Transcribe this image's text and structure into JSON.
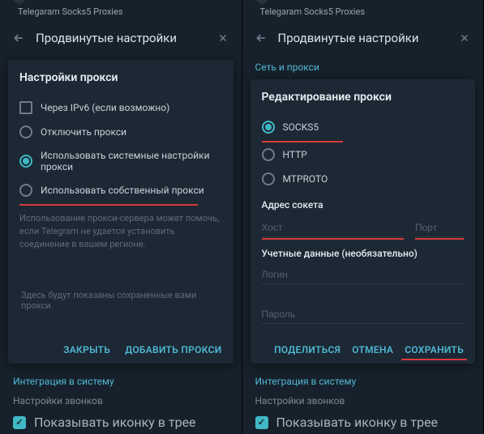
{
  "left": {
    "tab": "Telegaram Socks5 Proxies",
    "header": "Продвинутые настройки",
    "dialog_title": "Настройки прокси",
    "options": {
      "ipv6": "Через IPv6 (если возможно)",
      "disable": "Отключить прокси",
      "system": "Использовать системные настройки прокси",
      "custom": "Использовать собственный прокси"
    },
    "hint": "Использование прокси-сервера может помочь, если Telegram не удается установить соединение в вашем регионе.",
    "empty": "Здесь будут показаны сохраненные вами прокси.",
    "actions": {
      "close": "ЗАКРЫТЬ",
      "add": "ДОБАВИТЬ ПРОКСИ"
    },
    "bg": {
      "integration": "Интеграция в систему",
      "calls": "Настройки звонков",
      "tray": "Показывать иконку в трее"
    }
  },
  "right": {
    "tab": "Telegaram Socks5 Proxies",
    "header": "Продвинутые настройки",
    "section": "Сеть и прокси",
    "dialog_title": "Редактирование прокси",
    "types": {
      "socks5": "SOCKS5",
      "http": "HTTP",
      "mtproto": "MTPROTO"
    },
    "socket_title": "Адрес сокета",
    "host_ph": "Хост",
    "port_ph": "Порт",
    "creds_title": "Учетные данные (необязательно)",
    "login_ph": "Логин",
    "pass_ph": "Пароль",
    "actions": {
      "share": "ПОДЕЛИТЬСЯ",
      "cancel": "ОТМЕНА",
      "save": "СОХРАНИТЬ"
    },
    "bg": {
      "integration": "Интеграция в систему",
      "calls": "Настройки звонков",
      "tray": "Показывать иконку в трее"
    }
  }
}
